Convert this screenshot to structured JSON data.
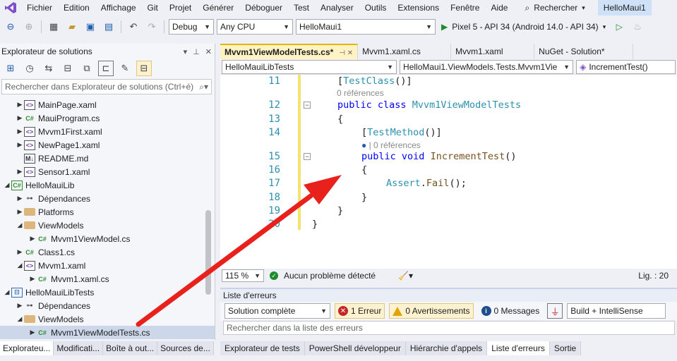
{
  "menu": {
    "items": [
      "Fichier",
      "Edition",
      "Affichage",
      "Git",
      "Projet",
      "Générer",
      "Déboguer",
      "Test",
      "Analyser",
      "Outils",
      "Extensions",
      "Fenêtre",
      "Aide"
    ],
    "search_label": "Rechercher",
    "window_title": "HelloMaui1"
  },
  "toolbar": {
    "config": "Debug",
    "platform": "Any CPU",
    "startup_project": "HelloMaui1",
    "run_target": "Pixel 5 - API 34 (Android 14.0 - API 34)"
  },
  "solution_explorer": {
    "title": "Explorateur de solutions",
    "search_placeholder": "Rechercher dans Explorateur de solutions (Ctrl+é)",
    "items": [
      {
        "label": "MainPage.xaml",
        "icon": "xaml-file-icon",
        "expander": "▶"
      },
      {
        "label": "MauiProgram.cs",
        "icon": "csharp-file-icon",
        "expander": "▶"
      },
      {
        "label": "Mvvm1First.xaml",
        "icon": "xaml-file-icon",
        "expander": "▶"
      },
      {
        "label": "NewPage1.xaml",
        "icon": "xaml-file-icon",
        "expander": "▶"
      },
      {
        "label": "README.md",
        "icon": "markdown-file-icon",
        "expander": ""
      },
      {
        "label": "Sensor1.xaml",
        "icon": "xaml-file-icon",
        "expander": "▶"
      },
      {
        "label": "HelloMauiLib",
        "icon": "csharp-project-icon",
        "expander": "◢"
      },
      {
        "label": "Dépendances",
        "icon": "dependencies-icon",
        "expander": "▶"
      },
      {
        "label": "Platforms",
        "icon": "folder-icon",
        "expander": "▶"
      },
      {
        "label": "ViewModels",
        "icon": "folder-icon",
        "expander": "◢"
      },
      {
        "label": "Mvvm1ViewModel.cs",
        "icon": "csharp-file-icon",
        "expander": "▶"
      },
      {
        "label": "Class1.cs",
        "icon": "csharp-file-icon",
        "expander": "▶"
      },
      {
        "label": "Mvvm1.xaml",
        "icon": "xaml-file-icon",
        "expander": "◢"
      },
      {
        "label": "Mvvm1.xaml.cs",
        "icon": "csharp-file-icon",
        "expander": "▶"
      },
      {
        "label": "HelloMauiLibTests",
        "icon": "test-project-icon",
        "expander": "◢"
      },
      {
        "label": "Dépendances",
        "icon": "dependencies-icon",
        "expander": "▶"
      },
      {
        "label": "ViewModels",
        "icon": "folder-icon",
        "expander": "◢"
      },
      {
        "label": "Mvvm1ViewModelTests.cs",
        "icon": "csharp-file-icon",
        "expander": "▶"
      }
    ],
    "bottom_tabs": [
      "Explorateu...",
      "Modificati...",
      "Boîte à out...",
      "Sources de..."
    ]
  },
  "editor": {
    "tabs": [
      {
        "label": "Mvvm1ViewModelTests.cs*",
        "active": true
      },
      {
        "label": "Mvvm1.xaml.cs",
        "active": false
      },
      {
        "label": "Mvvm1.xaml",
        "active": false
      },
      {
        "label": "NuGet - Solution*",
        "active": false
      }
    ],
    "nav_project": "HelloMauiLibTests",
    "nav_class": "HelloMaui1.ViewModels.Tests.Mvvm1Vie",
    "nav_member": "IncrementTest()",
    "line_numbers": [
      "11",
      "12",
      "13",
      "14",
      "15",
      "16",
      "17",
      "18",
      "19",
      "20"
    ],
    "code": {
      "l11_attr": "TestClass",
      "ref_class": "0 références",
      "l12_public": "public",
      "l12_class": "class",
      "l12_name": "Mvvm1ViewModelTests",
      "l13": "{",
      "l14_attr": "TestMethod",
      "ref_method": "0 références",
      "l15_public": "public",
      "l15_void": "void",
      "l15_name": "IncrementTest",
      "l16": "{",
      "l17_cls": "Assert",
      "l17_meth": "Fail",
      "l18": "}",
      "l19": "}",
      "l20": "}"
    },
    "zoom": "115 %",
    "status_message": "Aucun problème détecté",
    "line_indicator": "Lig. : 20"
  },
  "error_list": {
    "title": "Liste d'erreurs",
    "scope": "Solution complète",
    "errors": "1 Erreur",
    "warnings": "0 Avertissements",
    "messages": "0 Messages",
    "build_filter": "Build + IntelliSense",
    "search_placeholder": "Rechercher dans la liste des erreurs"
  },
  "bottom_tabs": [
    "Explorateur de tests",
    "PowerShell développeur",
    "Hiérarchie d'appels",
    "Liste d'erreurs",
    "Sortie"
  ],
  "colors": {
    "arrow": "#e8211c",
    "keyword": "#0000ff",
    "type": "#2b91af"
  }
}
